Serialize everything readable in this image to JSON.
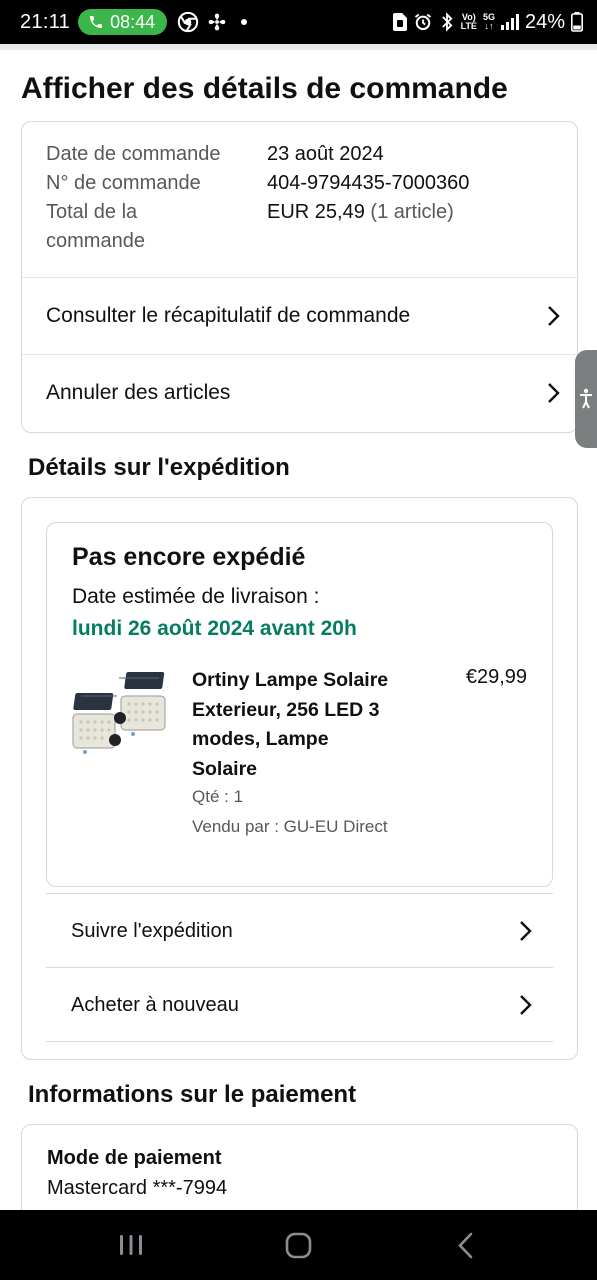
{
  "status_bar": {
    "time": "21:11",
    "call_time": "08:44",
    "battery": "24%",
    "volte_top": "Vo)",
    "volte_bottom": "LTE",
    "net_top": "5G",
    "net_bottom": "↓↑"
  },
  "page_title": "Afficher des détails de commande",
  "order": {
    "date_label": "Date de commande",
    "date_value": "23 août 2024",
    "number_label": "N° de commande",
    "number_value": "404-9794435-7000360",
    "total_label": "Total de la commande",
    "total_value": "EUR 25,49",
    "total_items": "(1 article)",
    "links": [
      {
        "label": "Consulter le récapitulatif de commande"
      },
      {
        "label": "Annuler des articles"
      }
    ]
  },
  "shipping": {
    "section_title": "Détails sur l'expédition",
    "status": "Pas encore expédié",
    "eta_label": "Date estimée de livraison :",
    "eta_date": "lundi 26 août 2024 avant 20h",
    "product": {
      "name": "Ortiny Lampe Solaire Exterieur, 256 LED 3 modes, Lampe Solaire",
      "price": "€29,99",
      "quantity": "Qté : 1",
      "seller": "Vendu par : GU-EU Direct"
    },
    "actions": [
      {
        "label": "Suivre l'expédition"
      },
      {
        "label": "Acheter à nouveau"
      }
    ]
  },
  "payment": {
    "section_title": "Informations sur le paiement",
    "method_label": "Mode de paiement",
    "method_value": "Mastercard ***-7994"
  },
  "colors": {
    "delivery_green": "#067d62",
    "call_pill_green": "#3bb64a",
    "border": "#d5d9d9",
    "muted_text": "#565959"
  },
  "icons": [
    "phone-icon",
    "chrome-icon",
    "fan-icon",
    "sim-icon",
    "alarm-icon",
    "bluetooth-icon",
    "signal-icon",
    "battery-icon",
    "chevron-right-icon",
    "accessibility-icon",
    "recents-icon",
    "home-icon",
    "back-icon"
  ]
}
